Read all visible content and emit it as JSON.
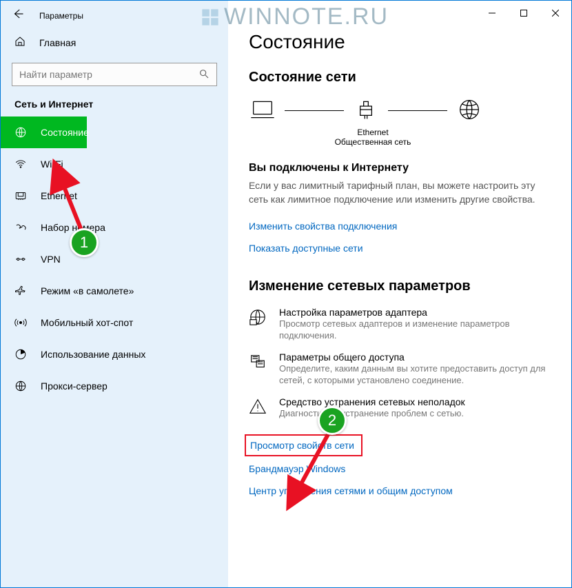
{
  "window": {
    "title": "Параметры"
  },
  "watermark": "WINNOTE.RU",
  "sidebar": {
    "home": "Главная",
    "search_placeholder": "Найти параметр",
    "section": "Сеть и Интернет",
    "items": [
      {
        "label": "Состояние",
        "icon": "globe-icon",
        "active": true
      },
      {
        "label": "Wi-Fi",
        "icon": "wifi-icon"
      },
      {
        "label": "Ethernet",
        "icon": "ethernet-icon"
      },
      {
        "label": "Набор номера",
        "icon": "dialup-icon"
      },
      {
        "label": "VPN",
        "icon": "vpn-icon"
      },
      {
        "label": "Режим «в самолете»",
        "icon": "airplane-icon"
      },
      {
        "label": "Мобильный хот-спот",
        "icon": "hotspot-icon"
      },
      {
        "label": "Использование данных",
        "icon": "datausage-icon"
      },
      {
        "label": "Прокси-сервер",
        "icon": "proxy-icon"
      }
    ]
  },
  "main": {
    "heading": "Состояние",
    "status_heading": "Состояние сети",
    "diagram": {
      "label1": "Ethernet",
      "label2": "Общественная сеть"
    },
    "connected_title": "Вы подключены к Интернету",
    "connected_text": "Если у вас лимитный тарифный план, вы можете настроить эту сеть как лимитное подключение или изменить другие свойства.",
    "link_props": "Изменить свойства подключения",
    "link_nets": "Показать доступные сети",
    "change_heading": "Изменение сетевых параметров",
    "rows": [
      {
        "title": "Настройка параметров адаптера",
        "desc": "Просмотр сетевых адаптеров и изменение параметров подключения."
      },
      {
        "title": "Параметры общего доступа",
        "desc": "Определите, каким данным вы хотите предоставить доступ для сетей, с которыми установлено соединение."
      },
      {
        "title": "Средство устранения сетевых неполадок",
        "desc": "Диагностика и устранение проблем с сетью."
      }
    ],
    "link_view": "Просмотр свойств сети",
    "link_firewall": "Брандмауэр Windows",
    "link_center": "Центр управления сетями и общим доступом"
  },
  "annotations": {
    "badge1": "1",
    "badge2": "2"
  }
}
